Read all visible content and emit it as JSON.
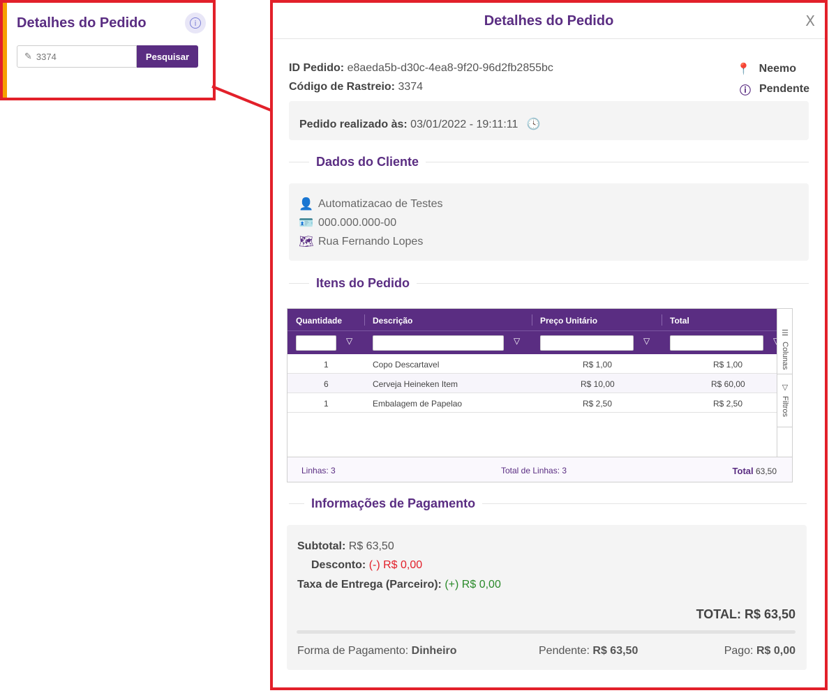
{
  "mini_panel": {
    "title": "Detalhes do Pedido",
    "info_icon": "info-icon",
    "search_value": "3374",
    "search_button": "Pesquisar"
  },
  "modal": {
    "title": "Detalhes do Pedido",
    "close": "X",
    "order_id_label": "ID Pedido:",
    "order_id": "e8aeda5b-d30c-4ea8-9f20-96d2fb2855bc",
    "tracking_label": "Código de Rastreio:",
    "tracking": "3374",
    "store": "Neemo",
    "status": "Pendente",
    "placed_label": "Pedido realizado às:",
    "placed_at": "03/01/2022 - 19:11:11",
    "client_section": "Dados do Cliente",
    "client": {
      "name": "Automatizacao de Testes",
      "document": "000.000.000-00",
      "address": "Rua Fernando Lopes"
    },
    "items_section": "Itens do Pedido",
    "grid": {
      "columns": [
        "Quantidade",
        "Descrição",
        "Preço Unitário",
        "Total"
      ],
      "side_tools": [
        "Colunas",
        "Filtros"
      ],
      "rows": [
        {
          "qty": "1",
          "desc": "Copo Descartavel",
          "unit": "R$ 1,00",
          "total": "R$ 1,00"
        },
        {
          "qty": "6",
          "desc": "Cerveja Heineken Item",
          "unit": "R$ 10,00",
          "total": "R$ 60,00"
        },
        {
          "qty": "1",
          "desc": "Embalagem de Papelao",
          "unit": "R$ 2,50",
          "total": "R$ 2,50"
        }
      ],
      "footer_lines": "Linhas: 3",
      "footer_total_lines": "Total de Linhas: 3",
      "footer_total_label": "Total",
      "footer_total_value": "63,50"
    },
    "payment_section": "Informações de Pagamento",
    "payment": {
      "subtotal_label": "Subtotal:",
      "subtotal": "R$ 63,50",
      "discount_label": "Desconto:",
      "discount_sign": "(-)",
      "discount": "R$ 0,00",
      "delivery_label": "Taxa de Entrega (Parceiro):",
      "delivery_sign": "(+)",
      "delivery": "R$ 0,00",
      "total": "TOTAL: R$ 63,50",
      "method_label": "Forma de Pagamento:",
      "method": "Dinheiro",
      "pending_label": "Pendente:",
      "pending": "R$ 63,50",
      "paid_label": "Pago:",
      "paid": "R$ 0,00"
    }
  },
  "colors": {
    "brand": "#5a2d82",
    "highlight": "#e2202a",
    "accent": "#f5a000"
  }
}
